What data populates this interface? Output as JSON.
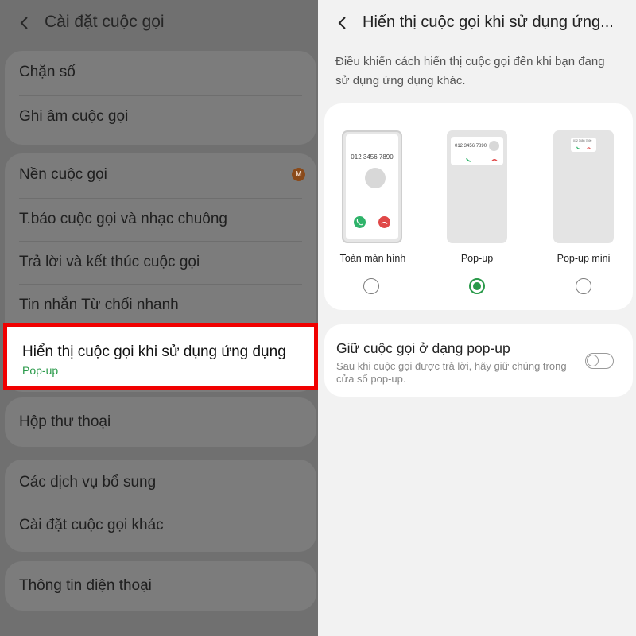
{
  "left": {
    "title": "Cài đặt cuộc gọi",
    "groups": [
      {
        "items": [
          "Chặn số",
          "Ghi âm cuộc gọi"
        ]
      },
      {
        "items": [
          "Nền cuộc gọi",
          "T.báo cuộc gọi và nhạc chuông",
          "Trả lời và kết thúc cuộc gọi",
          "Tin nhắn Từ chối nhanh"
        ]
      },
      {
        "items": [
          "Hộp thư thoại"
        ]
      },
      {
        "items": [
          "Các dịch vụ bổ sung",
          "Cài đặt cuộc gọi khác"
        ]
      },
      {
        "items": [
          "Thông tin điện thoại"
        ]
      }
    ],
    "badge": "M",
    "highlighted": {
      "title": "Hiển thị cuộc gọi khi sử dụng ứng dụng",
      "subtitle": "Pop-up"
    },
    "highlight_color": "#f00000"
  },
  "right": {
    "title": "Hiển thị cuộc gọi khi sử dụng ứng...",
    "description": "Điều khiển cách hiển thị cuộc gọi đến khi bạn đang sử dụng ứng dụng khác.",
    "options": [
      {
        "label": "Toàn màn hình",
        "selected": false
      },
      {
        "label": "Pop-up",
        "selected": true
      },
      {
        "label": "Pop-up mini",
        "selected": false
      }
    ],
    "preview_number": "012 3456 7890",
    "keep_popup": {
      "title": "Giữ cuộc gọi ở dạng pop-up",
      "description": "Sau khi cuộc gọi được trả lời, hãy giữ chúng trong cửa sổ pop-up.",
      "enabled": false
    },
    "accent_color": "#2a9a4a"
  }
}
